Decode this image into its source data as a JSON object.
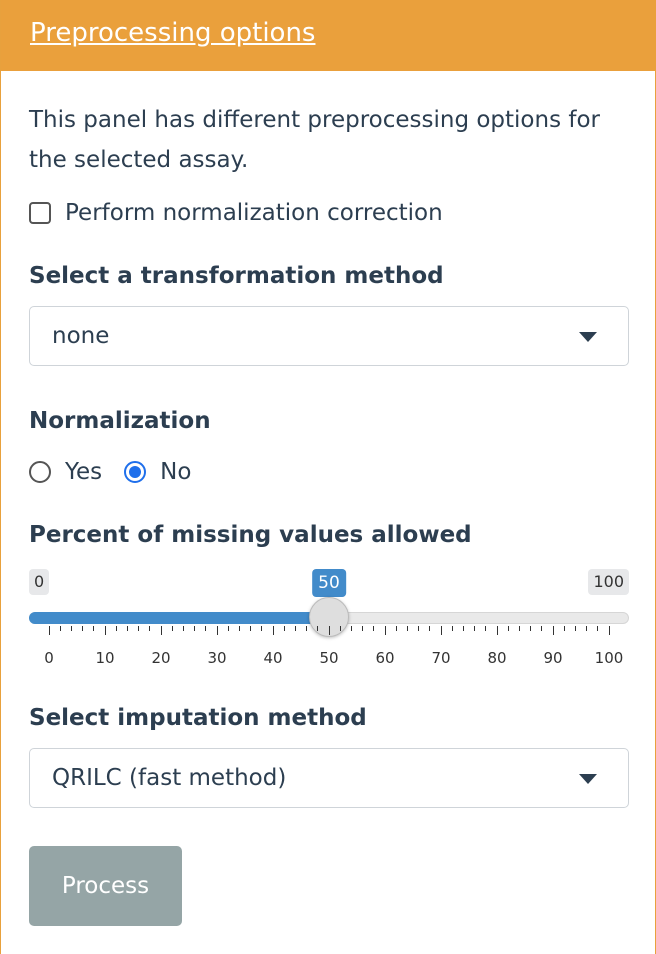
{
  "panel": {
    "title": "Preprocessing options",
    "description": "This panel has different preprocessing options for the selected assay.",
    "accent_color": "#eaa03c"
  },
  "normalization_correction": {
    "label": "Perform normalization correction",
    "checked": false
  },
  "transformation": {
    "label": "Select a transformation method",
    "selected": "none"
  },
  "normalization": {
    "label": "Normalization",
    "options": [
      "Yes",
      "No"
    ],
    "selected": "No"
  },
  "missing_values": {
    "label": "Percent of missing values allowed",
    "min": 0,
    "max": 100,
    "value": 50,
    "min_label": "0",
    "max_label": "100",
    "value_label": "50",
    "tick_labels": [
      "0",
      "10",
      "20",
      "30",
      "40",
      "50",
      "60",
      "70",
      "80",
      "90",
      "100"
    ]
  },
  "imputation": {
    "label": "Select imputation method",
    "selected": "QRILC (fast method)"
  },
  "process_button": {
    "label": "Process",
    "color": "#95a5a6"
  }
}
